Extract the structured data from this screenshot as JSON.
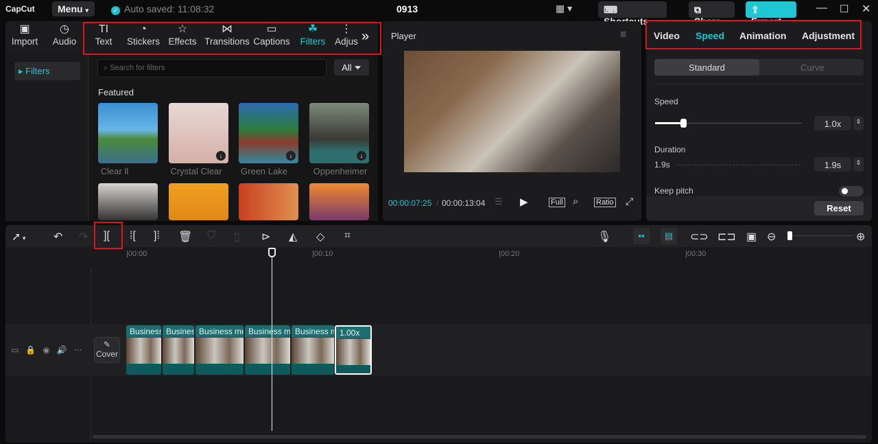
{
  "app": {
    "logo": "CapCut",
    "menu": "Menu",
    "autosave": "Auto saved: 11:08:32",
    "project": "0913",
    "shortcuts": "Shortcuts",
    "share": "Share",
    "export": "Export"
  },
  "media_tabs": [
    {
      "label": "Import",
      "icon": "import-icon"
    },
    {
      "label": "Audio",
      "icon": "audio-icon"
    },
    {
      "label": "Text",
      "icon": "text-icon"
    },
    {
      "label": "Stickers",
      "icon": "sticker-icon"
    },
    {
      "label": "Effects",
      "icon": "effects-icon"
    },
    {
      "label": "Transitions",
      "icon": "transition-icon"
    },
    {
      "label": "Captions",
      "icon": "captions-icon"
    },
    {
      "label": "Filters",
      "icon": "filters-icon",
      "active": true
    },
    {
      "label": "Adjus",
      "icon": "adjust-icon"
    }
  ],
  "filters": {
    "sidebar_item": "Filters",
    "search_placeholder": "Search for filters",
    "all": "All",
    "section": "Featured",
    "items": [
      {
        "name": "Clear ll"
      },
      {
        "name": "Crystal Clear"
      },
      {
        "name": "Green Lake"
      },
      {
        "name": "Oppenheimer"
      }
    ]
  },
  "player": {
    "title": "Player",
    "current": "00:00:07:25",
    "total": "00:00:13:04",
    "full": "Full",
    "ratio": "Ratio"
  },
  "inspector": {
    "tabs": [
      "Video",
      "Speed",
      "Animation",
      "Adjustment"
    ],
    "active_tab": "Speed",
    "modes": [
      "Standard",
      "Curve"
    ],
    "speed_label": "Speed",
    "speed_value": "1.0x",
    "duration_label": "Duration",
    "duration_from": "1.9s",
    "duration_value": "1.9s",
    "keep_pitch": "Keep pitch",
    "keep_pitch_on": false,
    "reset": "Reset"
  },
  "timeline": {
    "ruler": [
      "00:00",
      "00:10",
      "00:20",
      "00:30"
    ],
    "cover": "Cover",
    "clips": [
      {
        "label": "Business"
      },
      {
        "label": "Busines"
      },
      {
        "label": "Business me"
      },
      {
        "label": "Business me"
      },
      {
        "label": "Business m"
      },
      {
        "label": "1.00x"
      }
    ]
  },
  "colors": {
    "accent": "#1fc7d4",
    "highlight": "#e0141a"
  }
}
